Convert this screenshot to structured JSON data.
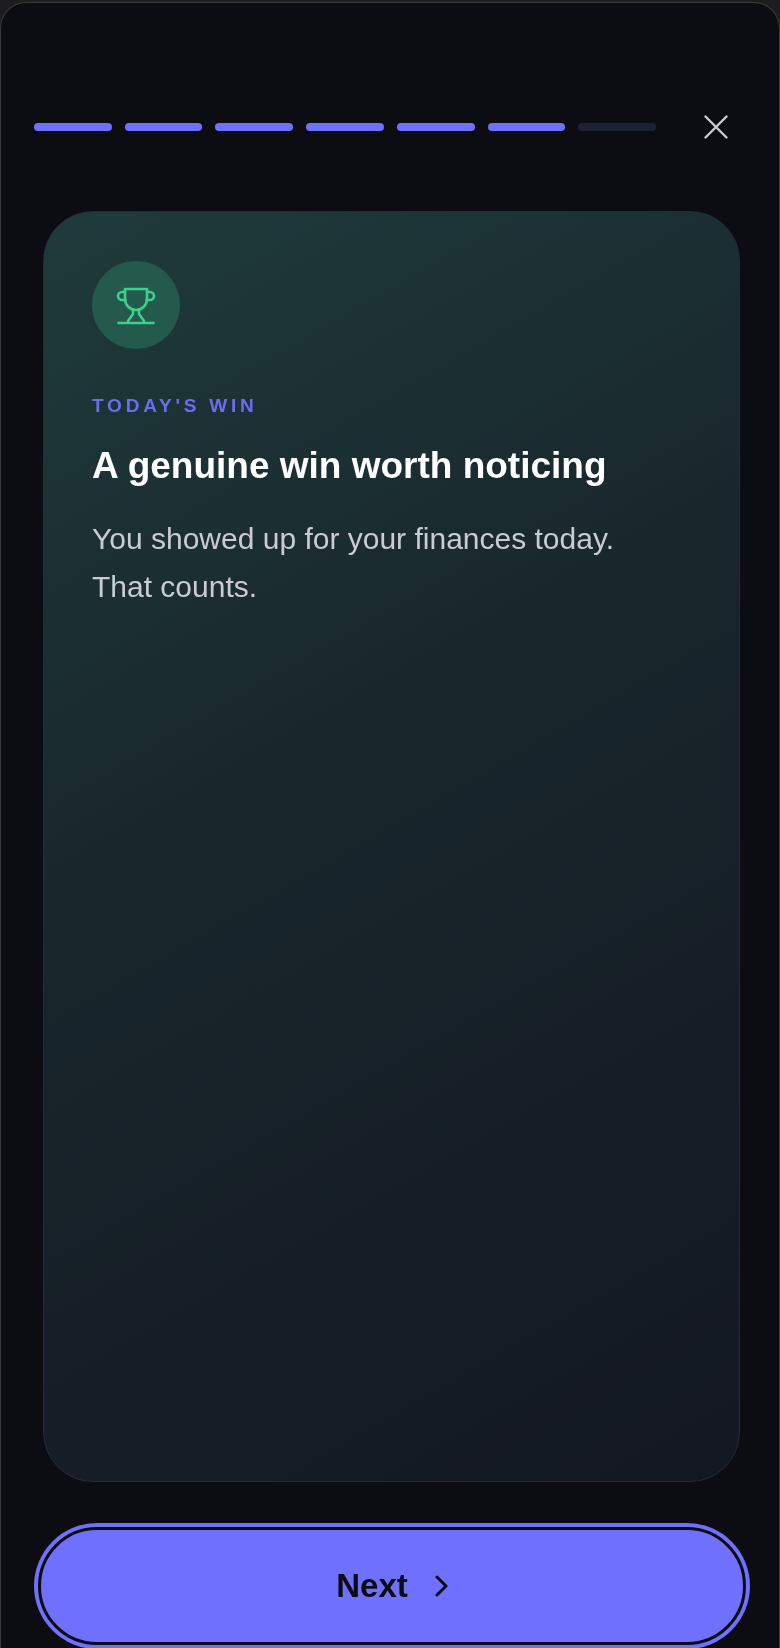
{
  "progress": {
    "steps": [
      {
        "completed": true
      },
      {
        "completed": true
      },
      {
        "completed": true
      },
      {
        "completed": true
      },
      {
        "completed": true
      },
      {
        "completed": true
      },
      {
        "completed": false
      }
    ]
  },
  "card": {
    "eyebrow": "TODAY'S WIN",
    "title": "A genuine win worth noticing",
    "message": "You showed up for your finances today. That counts."
  },
  "next_button": {
    "label": "Next"
  }
}
